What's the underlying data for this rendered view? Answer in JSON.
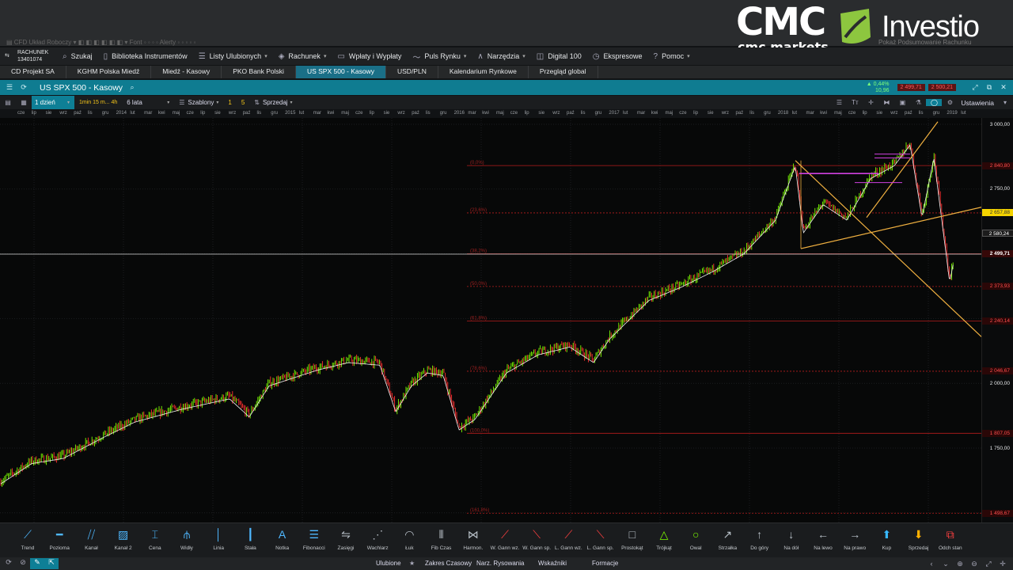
{
  "brand": {
    "cmc_main": "CMC",
    "cmc_sub": "cmc markets",
    "partner": "Investio"
  },
  "mini_strip": "▤ CFD  Układ Roboczy  ▾  ◧ ◧ ◧ ◧ ◧ ◧  ▾     Font  ◦ ◦  ◦ ◦     Alerty  ◦ ◦ ◦ ◦ ◦",
  "mini_right": "Pokaż Podsumowanie Rachunku",
  "menu": {
    "account_label": "RACHUNEK",
    "account_number": "13401074",
    "items": [
      {
        "icon": "search-icon",
        "label": "Szukaj",
        "caret": false
      },
      {
        "icon": "library-icon",
        "label": "Biblioteka Instrumentów",
        "caret": false
      },
      {
        "icon": "list-icon",
        "label": "Listy Ulubionych",
        "caret": true
      },
      {
        "icon": "tag-icon",
        "label": "Rachunek",
        "caret": true
      },
      {
        "icon": "wallet-icon",
        "label": "Wpłaty i Wypłaty",
        "caret": false
      },
      {
        "icon": "pulse-icon",
        "label": "Puls Rynku",
        "caret": true
      },
      {
        "icon": "tools-icon",
        "label": "Narzędzia",
        "caret": true
      },
      {
        "icon": "digital-icon",
        "label": "Digital 100",
        "caret": false
      },
      {
        "icon": "clock-icon",
        "label": "Ekspresowe",
        "caret": false
      },
      {
        "icon": "help-icon",
        "label": "Pomoc",
        "caret": true
      }
    ]
  },
  "tabs": [
    {
      "label": "CD Projekt SA",
      "active": false
    },
    {
      "label": "KGHM Polska Miedź",
      "active": false
    },
    {
      "label": "Miedź - Kasowy",
      "active": false
    },
    {
      "label": "PKO Bank Polski",
      "active": false
    },
    {
      "label": "US SPX 500 - Kasowy",
      "active": true
    },
    {
      "label": "USD/PLN",
      "active": false
    },
    {
      "label": "Kalendarium Rynkowe",
      "active": false
    },
    {
      "label": "Przegląd global",
      "active": false
    }
  ],
  "instrument": {
    "title": "US SPX 500 - Kasowy",
    "change_pct": "▲ 0,44%",
    "change_abs": "10,96",
    "sell_price": "2 499,71",
    "buy_price": "2 500,21"
  },
  "chart_toolbar": {
    "period": "1 dzień",
    "intervals": "1min  15 m...  4h",
    "range": "6 lata",
    "templates": "Szablony",
    "quick1": "1",
    "quick2": "5",
    "order": "Sprzedaj",
    "settings": "Ustawienia"
  },
  "time_axis": [
    "cze",
    "lip",
    "sie",
    "wrz",
    "paź",
    "lis",
    "gru",
    "2014",
    "lut",
    "mar",
    "kwi",
    "maj",
    "cze",
    "lip",
    "sie",
    "wrz",
    "paź",
    "lis",
    "gru",
    "2015",
    "lut",
    "mar",
    "kwi",
    "maj",
    "cze",
    "lip",
    "sie",
    "wrz",
    "paź",
    "lis",
    "gru",
    "2016",
    "mar",
    "kwi",
    "maj",
    "cze",
    "lip",
    "sie",
    "wrz",
    "paź",
    "lis",
    "gru",
    "2017",
    "lut",
    "mar",
    "kwi",
    "maj",
    "cze",
    "lip",
    "sie",
    "wrz",
    "paź",
    "lis",
    "gru",
    "2018",
    "lut",
    "mar",
    "kwi",
    "maj",
    "cze",
    "lip",
    "sie",
    "wrz",
    "paź",
    "lis",
    "gru",
    "2019",
    "lut"
  ],
  "fib_labels": [
    "(0,0%)",
    "(23,6%)",
    "(38,2%)",
    "(50,0%)",
    "(61,8%)",
    "(78,6%)",
    "(100,0%)",
    "(161,8%)"
  ],
  "price_axis": [
    {
      "text": "3 000,00",
      "style": "plain"
    },
    {
      "text": "2 840,80",
      "style": "red"
    },
    {
      "text": "2 750,00",
      "style": "plain"
    },
    {
      "text": "2 657,88",
      "style": "yellow"
    },
    {
      "text": "2 580,24",
      "style": "white"
    },
    {
      "text": "2 499,71",
      "style": "current"
    },
    {
      "text": "2 373,93",
      "style": "red"
    },
    {
      "text": "2 240,14",
      "style": "red"
    },
    {
      "text": "2 046,67",
      "style": "red"
    },
    {
      "text": "2 000,00",
      "style": "plain"
    },
    {
      "text": "1 807,05",
      "style": "red"
    },
    {
      "text": "1 750,00",
      "style": "plain"
    },
    {
      "text": "1 498,67",
      "style": "red"
    }
  ],
  "draw_tools": [
    {
      "icon": "trend-line-icon",
      "label": "Trend"
    },
    {
      "icon": "horizontal-line-icon",
      "label": "Pozioma"
    },
    {
      "icon": "channel-icon",
      "label": "Kanał"
    },
    {
      "icon": "channel-2-icon",
      "label": "Kanał 2"
    },
    {
      "icon": "price-icon",
      "label": "Cena"
    },
    {
      "icon": "pitchfork-icon",
      "label": "Widły"
    },
    {
      "icon": "vertical-line-icon",
      "label": "Linia"
    },
    {
      "icon": "constant-icon",
      "label": "Stała"
    },
    {
      "icon": "note-icon",
      "label": "Notka"
    },
    {
      "icon": "fibonacci-icon",
      "label": "Fibonacci"
    },
    {
      "icon": "arrows-icon",
      "label": "Zasięgi"
    },
    {
      "icon": "fan-icon",
      "label": "Wachlarz"
    },
    {
      "icon": "arc-icon",
      "label": "Łuk"
    },
    {
      "icon": "fib-time-icon",
      "label": "Fib Czas"
    },
    {
      "icon": "harmonic-icon",
      "label": "Harmon."
    },
    {
      "icon": "gann-fan-icon",
      "label": "W. Gann wz."
    },
    {
      "icon": "gann-fan-down-icon",
      "label": "W. Gann sp."
    },
    {
      "icon": "gann-line-icon",
      "label": "L. Gann wz."
    },
    {
      "icon": "gann-line-down-icon",
      "label": "L. Gann sp."
    },
    {
      "icon": "rectangle-icon",
      "label": "Prostokąt"
    },
    {
      "icon": "triangle-icon",
      "label": "Trójkąt"
    },
    {
      "icon": "ellipse-icon",
      "label": "Owal"
    },
    {
      "icon": "arrow-icon",
      "label": "Strzałka"
    },
    {
      "icon": "arrow-up-icon",
      "label": "Do góry"
    },
    {
      "icon": "arrow-down-icon",
      "label": "Na dół"
    },
    {
      "icon": "arrow-left-icon",
      "label": "Na lewo"
    },
    {
      "icon": "arrow-right-icon",
      "label": "Na prawo"
    },
    {
      "icon": "buy-icon",
      "label": "Kup"
    },
    {
      "icon": "sell-icon",
      "label": "Sprzedaj"
    },
    {
      "icon": "detach-icon",
      "label": "Odch stan"
    }
  ],
  "status_bar": {
    "favorites": "Ulubione",
    "time_range": "Zakres Czasowy",
    "drawing_tools": "Narz. Rysowania",
    "indicators": "Wskaźniki",
    "patterns": "Formacje"
  },
  "colors": {
    "accent": "#0f7c91",
    "bull": "#7cfc00",
    "bear": "#ff3030",
    "fib": "#b71c1c",
    "trendline": "#f0b040",
    "pattern": "#d040e0"
  }
}
